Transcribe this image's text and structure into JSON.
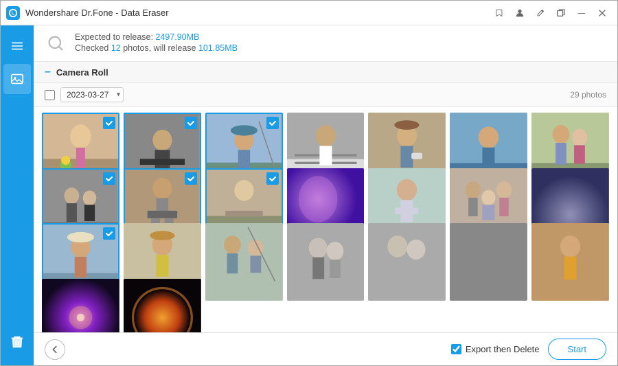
{
  "titlebar": {
    "title": "Wondershare Dr.Fone - Data Eraser",
    "controls": [
      "bookmark",
      "user",
      "edit",
      "restore",
      "minimize",
      "close"
    ]
  },
  "infobar": {
    "line1_prefix": "Expected to release: ",
    "line1_value": "2497.90MB",
    "line2_prefix": "Checked ",
    "line2_count": "12",
    "line2_suffix": " photos, will release ",
    "line2_size": "101.85MB"
  },
  "section": {
    "title": "Camera Roll"
  },
  "datebar": {
    "date": "2023-03-27",
    "photo_count": "29 photos"
  },
  "bottom": {
    "export_label": "Export then Delete",
    "start_label": "Start"
  },
  "photos": [
    {
      "id": 1,
      "checked": true,
      "palette": "p1"
    },
    {
      "id": 2,
      "checked": true,
      "palette": "p2"
    },
    {
      "id": 3,
      "checked": true,
      "palette": "p3"
    },
    {
      "id": 4,
      "checked": false,
      "palette": "p4"
    },
    {
      "id": 5,
      "checked": false,
      "palette": "p5"
    },
    {
      "id": 6,
      "checked": false,
      "palette": "p6"
    },
    {
      "id": 7,
      "checked": false,
      "palette": "p7"
    },
    {
      "id": 8,
      "checked": true,
      "palette": "p8"
    },
    {
      "id": 9,
      "checked": true,
      "palette": "p9"
    },
    {
      "id": 10,
      "checked": true,
      "palette": "p10"
    },
    {
      "id": 11,
      "checked": false,
      "palette": "p11"
    },
    {
      "id": 12,
      "checked": false,
      "palette": "p12"
    },
    {
      "id": 13,
      "checked": false,
      "palette": "p13"
    },
    {
      "id": 14,
      "checked": false,
      "palette": "p14"
    },
    {
      "id": 15,
      "checked": true,
      "palette": "p15"
    },
    {
      "id": 16,
      "checked": false,
      "palette": "p16"
    },
    {
      "id": 17,
      "checked": false,
      "palette": "p17"
    },
    {
      "id": 18,
      "checked": false,
      "palette": "p18"
    },
    {
      "id": 19,
      "checked": false,
      "palette": "p19"
    },
    {
      "id": 20,
      "checked": false,
      "palette": "p20"
    },
    {
      "id": 21,
      "checked": false,
      "palette": "pdark1"
    },
    {
      "id": 22,
      "checked": false,
      "palette": "pdark2"
    },
    {
      "id": 23,
      "checked": false,
      "palette": "pdark3"
    }
  ]
}
